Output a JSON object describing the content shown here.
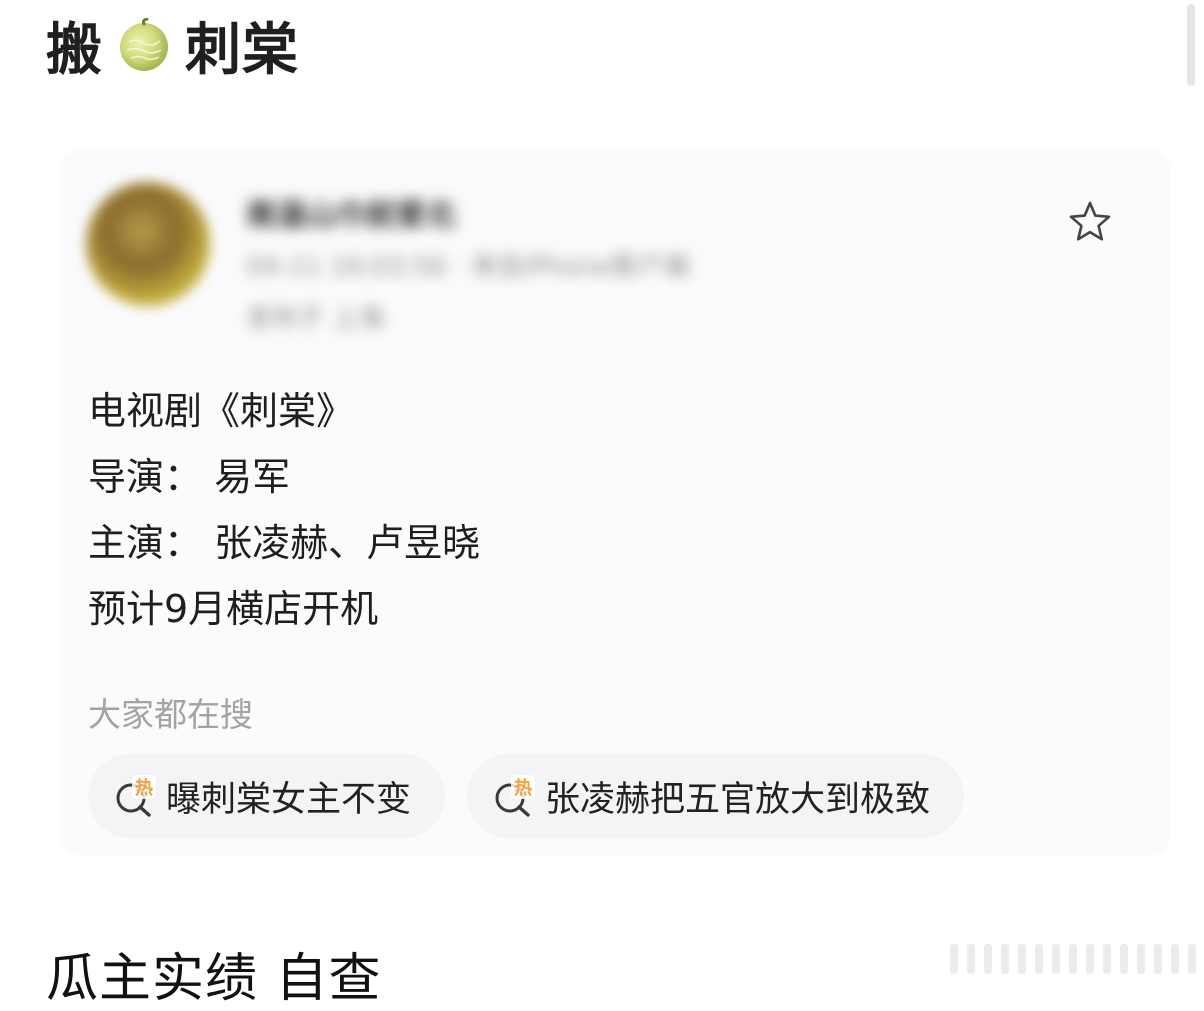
{
  "header": {
    "title_left": "搬",
    "title_right": "刺棠"
  },
  "post": {
    "author": {
      "name": "南温山巾前爱北",
      "meta": "04-11 16:03:56 · 来自iPhone客户端",
      "location": "发布于 上海"
    },
    "lines": [
      "电视剧《刺棠》",
      "导演： 易军",
      "主演： 张凌赫、卢昱晓",
      "预计9月横店开机"
    ],
    "search": {
      "title": "大家都在搜",
      "hot_badge": "热",
      "items": [
        "曝刺棠女主不变",
        "张凌赫把五官放大到极致"
      ]
    }
  },
  "footer": {
    "caption": "瓜主实绩 自查"
  },
  "icons": {
    "melon": "melon-icon",
    "star": "star-icon",
    "hot_search": "hot-search-icon"
  },
  "colors": {
    "hot_accent": "#f0a23b",
    "card_bg": "#fbfbfd",
    "pill_bg": "#f4f4f6"
  }
}
